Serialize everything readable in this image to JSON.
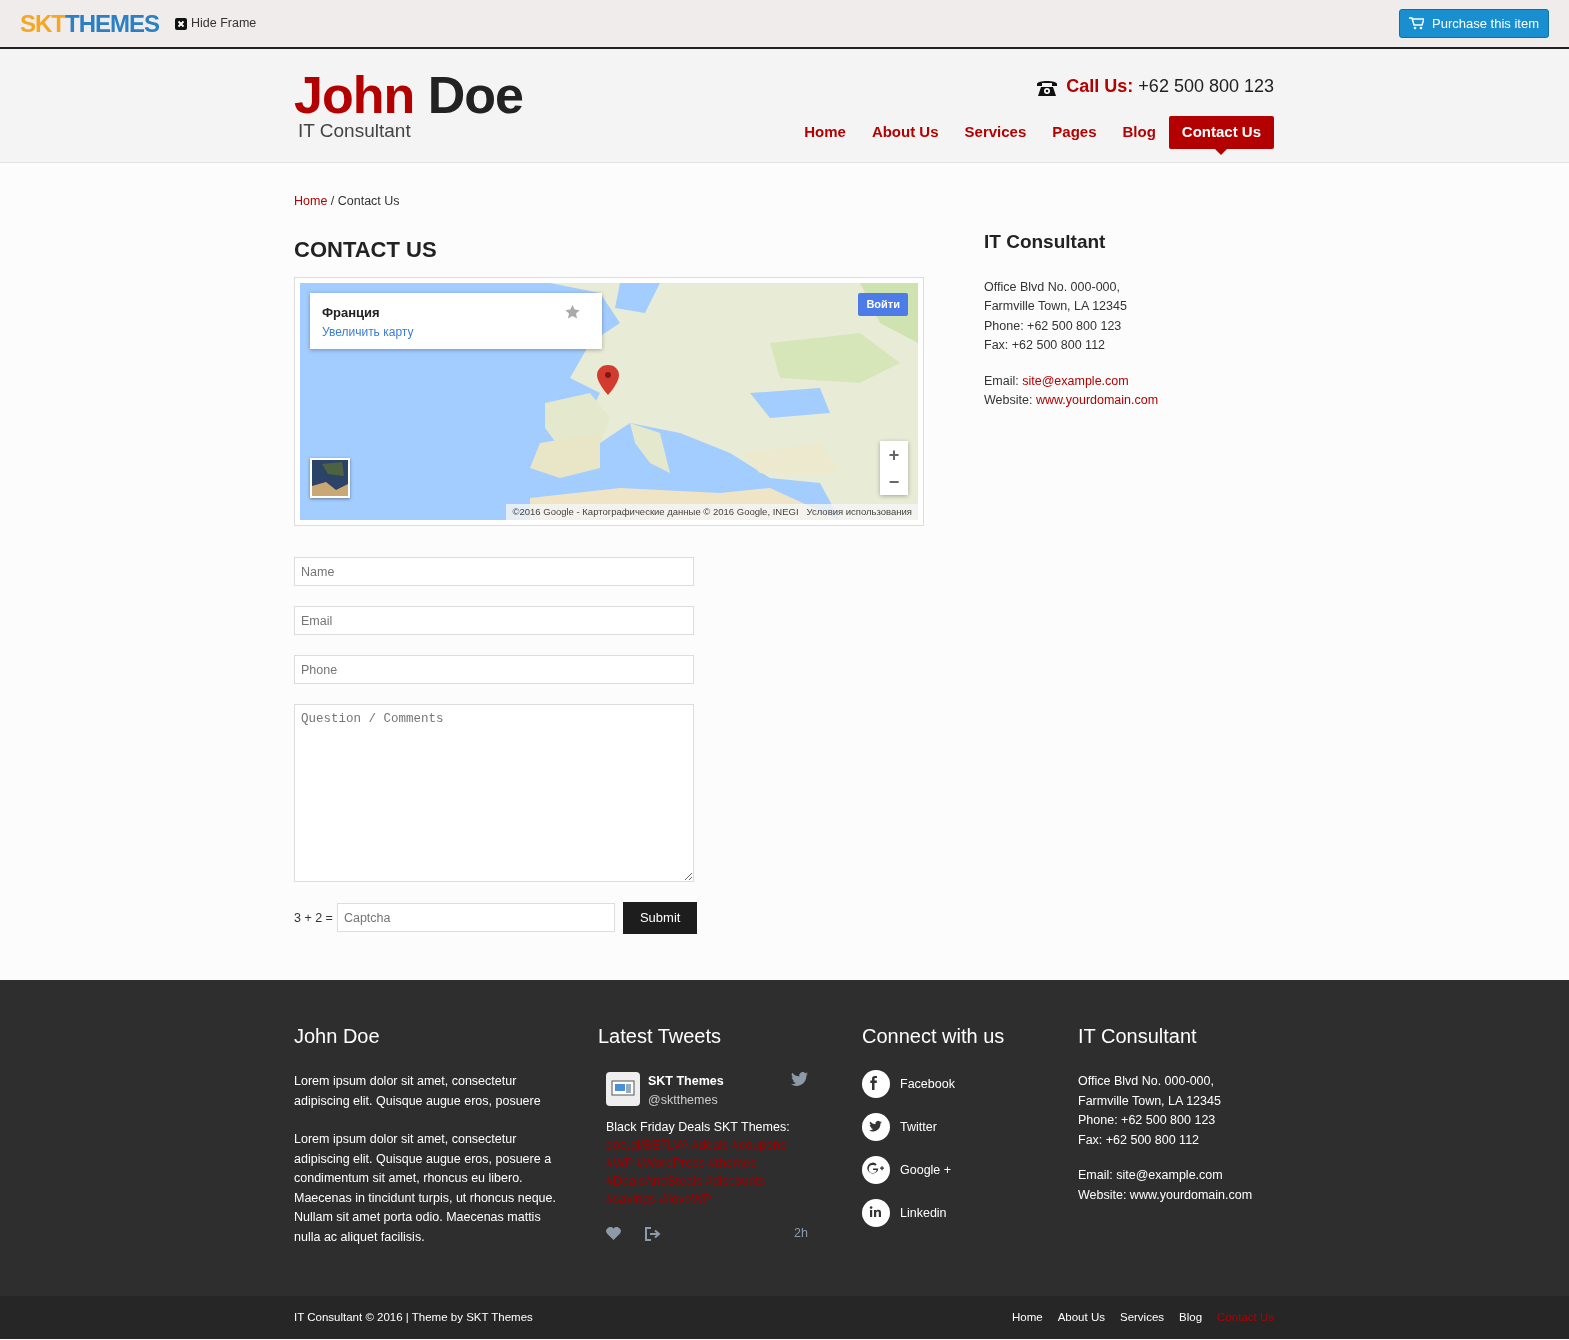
{
  "topbar": {
    "logo_parts": [
      "SKT",
      "THEMES"
    ],
    "hide_frame": "Hide Frame",
    "purchase": "Purchase this item"
  },
  "header": {
    "name_parts": [
      "John",
      "Doe"
    ],
    "tagline": "IT Consultant",
    "call_label": "Call Us:",
    "phone": "+62 500 800 123",
    "nav": [
      {
        "label": "Home",
        "selected": false
      },
      {
        "label": "About Us",
        "selected": false
      },
      {
        "label": "Services",
        "selected": false
      },
      {
        "label": "Pages",
        "selected": false
      },
      {
        "label": "Blog",
        "selected": false
      },
      {
        "label": "Contact Us",
        "selected": true
      }
    ]
  },
  "breadcrumb": {
    "home": "Home",
    "separator": "/",
    "current": "Contact Us"
  },
  "page_title": "CONTACT US",
  "map": {
    "kind": "picture",
    "place": "Франция",
    "enlarge": "Увеличить карту",
    "sign_in": "Войти",
    "zoom_in": "+",
    "zoom_out": "−",
    "attribution": "©2016 Google - Картографические данные © 2016 Google, INEGI",
    "terms": "Условия использования"
  },
  "form": {
    "fields": [
      {
        "kind": "input",
        "placeholder": "Name"
      },
      {
        "kind": "input",
        "placeholder": "Email"
      },
      {
        "kind": "input",
        "placeholder": "Phone"
      },
      {
        "kind": "textarea",
        "placeholder": "Question / Comments"
      }
    ],
    "captcha_label": "3 + 2 =",
    "captcha_placeholder": "Captcha",
    "submit": "Submit"
  },
  "sidebar": {
    "title": "IT Consultant",
    "address": [
      "Office Blvd No. 000-000,",
      "Farmville Town, LA 12345",
      "Phone: +62 500 800 123",
      "Fax: +62 500 800 112"
    ],
    "email_label": "Email:",
    "email": "site@example.com",
    "website_label": "Website:",
    "website": "www.yourdomain.com"
  },
  "footer": {
    "about": {
      "title": "John Doe",
      "paragraphs": [
        "Lorem ipsum dolor sit amet, consectetur adipiscing elit. Quisque augue eros, posuere",
        "Lorem ipsum dolor sit amet, consectetur adipiscing elit. Quisque augue eros, posuere a condimentum sit amet, rhoncus eu libero. Maecenas in tincidunt turpis, ut rhoncus neque. Nullam sit amet porta odio. Maecenas mattis nulla ac aliquet facilisis."
      ]
    },
    "tweets": {
      "title": "Latest Tweets",
      "name": "SKT Themes",
      "handle": "@sktthemes",
      "text": "Black Friday Deals SKT Themes:",
      "links": "goo.gl/BE7LVA #deals #coupons #WP #WordPress #themes #DealsAndSteals #discounts #savings #iloveWP",
      "time": "2h"
    },
    "connect": {
      "title": "Connect with us",
      "items": [
        {
          "kind": "facebook",
          "label": "Facebook"
        },
        {
          "kind": "twitter",
          "label": "Twitter"
        },
        {
          "kind": "google",
          "label": "Google +"
        },
        {
          "kind": "linkedin",
          "label": "Linkedin"
        }
      ]
    },
    "contact": {
      "title": "IT Consultant",
      "address": [
        "Office Blvd No. 000-000,",
        "Farmville Town, LA 12345",
        "Phone: +62 500 800 123",
        "Fax: +62 500 800 112"
      ],
      "email": "Email: site@example.com",
      "website": "Website: www.yourdomain.com"
    }
  },
  "bottom": {
    "copyright": "IT Consultant © 2016 | Theme by  SKT Themes",
    "nav": [
      {
        "label": "Home",
        "selected": false
      },
      {
        "label": "About Us",
        "selected": false
      },
      {
        "label": "Services",
        "selected": false
      },
      {
        "label": "Blog",
        "selected": false
      },
      {
        "label": "Contact Us",
        "selected": true
      }
    ]
  }
}
